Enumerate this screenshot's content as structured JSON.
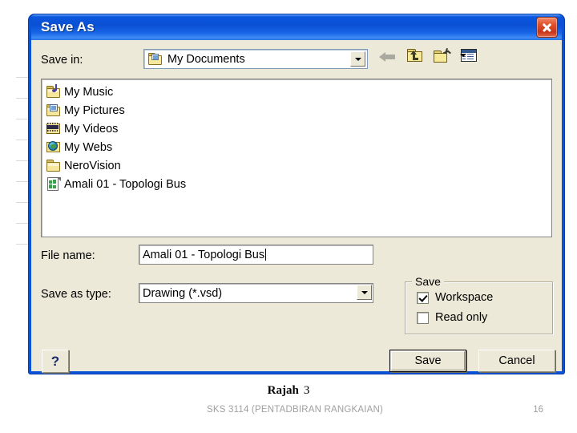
{
  "dialog": {
    "title": "Save As",
    "close_label": "Close",
    "save_in": {
      "label": "Save in:",
      "value": "My Documents",
      "icon": "my-documents-folder-icon"
    },
    "toolbar": [
      {
        "name": "back-icon",
        "label": "Back"
      },
      {
        "name": "up-one-level-icon",
        "label": "Up One Level"
      },
      {
        "name": "create-new-folder-icon",
        "label": "Create New Folder"
      },
      {
        "name": "views-icon",
        "label": "Views"
      }
    ],
    "file_list": [
      {
        "name": "My Music",
        "icon": "music-folder-icon"
      },
      {
        "name": "My Pictures",
        "icon": "pictures-folder-icon"
      },
      {
        "name": "My Videos",
        "icon": "videos-folder-icon"
      },
      {
        "name": "My Webs",
        "icon": "webs-folder-icon"
      },
      {
        "name": "NeroVision",
        "icon": "folder-icon"
      },
      {
        "name": "Amali 01 - Topologi Bus",
        "icon": "visio-document-icon"
      }
    ],
    "file_name": {
      "label": "File name:",
      "value": "Amali 01 - Topologi Bus"
    },
    "save_as_type": {
      "label": "Save as type:",
      "value": "Drawing (*.vsd)"
    },
    "save_group": {
      "title": "Save",
      "options": [
        {
          "label": "Workspace",
          "checked": true
        },
        {
          "label": "Read only",
          "checked": false
        }
      ]
    },
    "buttons": {
      "help": "?",
      "save": "Save",
      "cancel": "Cancel"
    }
  },
  "slide": {
    "caption_label": "Rajah",
    "caption_number": "3",
    "footer_left": "SKS 3114 (PENTADBIRAN RANGKAIAN)",
    "footer_right": "16"
  },
  "colors": {
    "titlebar_blue": "#0a52d6",
    "dialog_face": "#ece9d8",
    "close_red": "#e2512c",
    "folder_yellow": "#f7e79c"
  }
}
